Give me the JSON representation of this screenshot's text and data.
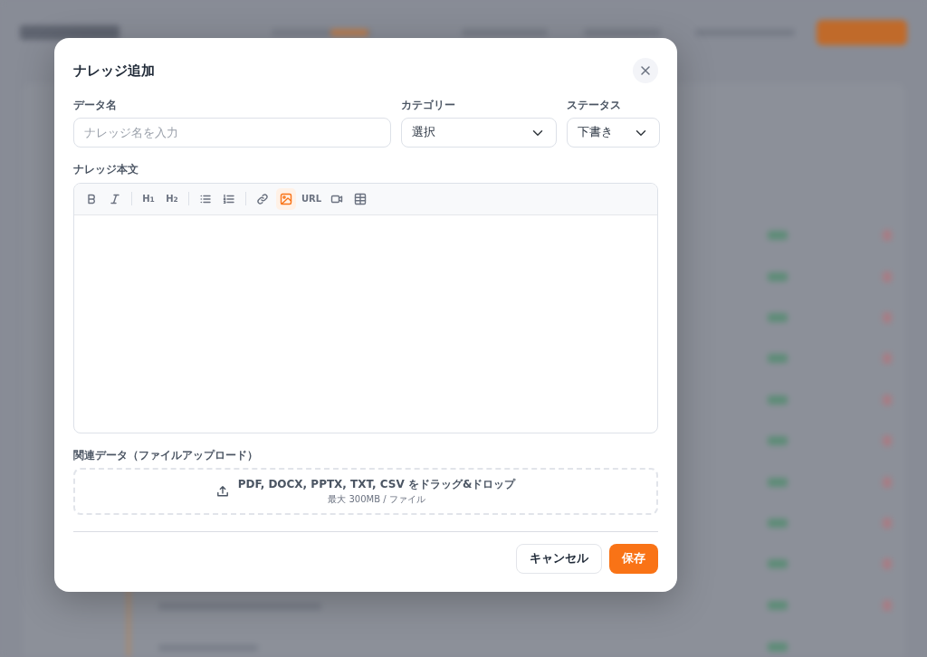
{
  "modal": {
    "title": "ナレッジ追加",
    "fields": [
      {
        "label": "データ名",
        "kind": "text",
        "placeholder": "ナレッジ名を入力"
      },
      {
        "label": "カテゴリー",
        "kind": "select",
        "value": "選択"
      },
      {
        "label": "ステータス",
        "kind": "select",
        "value": "下書き"
      }
    ],
    "editor": {
      "label": "ナレッジ本文",
      "tools": [
        {
          "kind": "bold",
          "selected": false
        },
        {
          "kind": "italic",
          "selected": false
        },
        {
          "kind": "divider"
        },
        {
          "kind": "heading",
          "label": "H$_{1}$",
          "selected": false
        },
        {
          "kind": "heading",
          "label": "H$_{2}$",
          "selected": false
        },
        {
          "kind": "divider"
        },
        {
          "kind": "bullets",
          "selected": false
        },
        {
          "kind": "numbers",
          "selected": false
        },
        {
          "kind": "divider"
        },
        {
          "kind": "link",
          "selected": false
        },
        {
          "kind": "image",
          "selected": true
        },
        {
          "kind": "text",
          "label": "URL",
          "selected": false
        },
        {
          "kind": "video",
          "selected": false
        },
        {
          "kind": "table",
          "selected": false
        }
      ]
    },
    "upload": {
      "label": "関連データ（ファイルアップロード）",
      "text": "PDF, DOCX, PPTX, TXT, CSV をドラッグ&ドロップ",
      "hint": "最大 300MB / ファイル"
    },
    "buttons": [
      {
        "label": "キャンセル",
        "kind": "secondary"
      },
      {
        "label": "保存",
        "kind": "primary"
      }
    ]
  }
}
